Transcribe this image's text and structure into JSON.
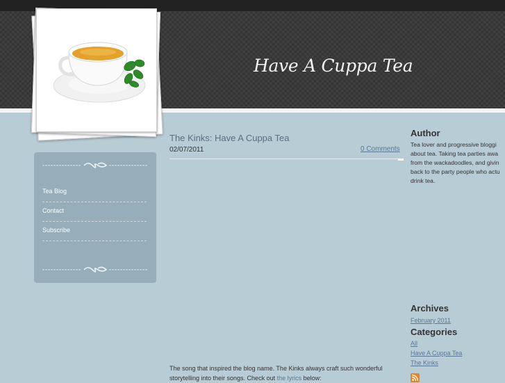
{
  "site": {
    "title": "Have A Cuppa Tea"
  },
  "nav": {
    "items": [
      {
        "label": "Tea Blog"
      },
      {
        "label": "Contact"
      },
      {
        "label": "Subscribe"
      }
    ]
  },
  "post": {
    "title": "The Kinks: Have A Cuppa Tea",
    "date": "02/07/2011",
    "comments": "0 Comments",
    "body_before": "The song that inspired the blog name. The Kinks always craft such wonderful storytelling into their songs. Check out ",
    "body_link": "the lyrics",
    "body_after": " below:"
  },
  "author": {
    "heading": "Author",
    "lines": [
      "Tea lover and progressive bloggi",
      "about tea. Taking tea parties awa",
      "from the wackadoodles, and givin",
      "back to the party people who actu",
      "drink tea."
    ]
  },
  "archives": {
    "heading": "Archives",
    "items": [
      "February 2011"
    ]
  },
  "categories": {
    "heading": "Categories",
    "items": [
      "All",
      "Have A Cuppa Tea",
      "The Kinks"
    ]
  },
  "icons": {
    "rss": "rss-feed-icon"
  },
  "colors": {
    "header_bg": "#3a3a3a",
    "page_bg": "#b8ccd6",
    "sidebar_bg": "#97aeba",
    "link": "#5a7894"
  }
}
